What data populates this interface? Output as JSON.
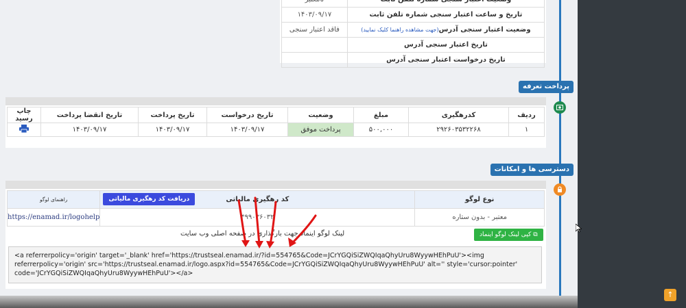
{
  "info_rows": [
    {
      "label": "وضعیت اعتبار سنجی شماره تلفن ثابت",
      "value": "نامعتبر",
      "link": ""
    },
    {
      "label": "تاریخ و ساعت اعتبار سنجی شماره تلفن ثابت",
      "value": "۱۴۰۳/۰۹/۱۷",
      "link": ""
    },
    {
      "label": "وضعیت اعتبار سنجی آدرس",
      "value": "فاقد اعتبار سنجی",
      "link": "(جهت مشاهده راهنما کلیک نمایید)"
    },
    {
      "label": "تاریخ اعتبار سنجی آدرس",
      "value": "",
      "link": ""
    },
    {
      "label": "تاریخ درخواست اعتبار سنجی آدرس",
      "value": "",
      "link": ""
    }
  ],
  "timeline": {
    "payment_label": "پرداخت تعرفه",
    "access_label": "دسترسی ها و امکانات",
    "payment_icon": "money-icon",
    "access_icon": "lock-icon",
    "accent": "#2a72b0"
  },
  "payment": {
    "headers": [
      "ردیف",
      "کدرهگیری",
      "مبلغ",
      "وضعیت",
      "تاریخ درخواست",
      "تاریخ پرداخت",
      "تاریخ انقضا پرداخت",
      "چاپ رسید"
    ],
    "rows": [
      [
        "۱",
        "۲۹۲۶۰۳۵۳۲۲۶۸",
        "۵۰۰,۰۰۰",
        "پرداخت موفق",
        "۱۴۰۳/۰۹/۱۷",
        "۱۴۰۳/۰۹/۱۷",
        "۱۴۰۳/۰۹/۱۷"
      ]
    ]
  },
  "logo": {
    "type_header": "نوع لوگو",
    "tracking_header": "کد رهگیری مالیاتی",
    "guide_header": "راهنمای لوگو",
    "tracking_button": "دریافت کد رهگیری مالیاتی",
    "type_value": "معتبر - بدون ستاره",
    "tracking_value": "۴۹۹۰۳۶۰۳۲",
    "guide_link": "https://enamad.ir/logohelp",
    "copy_button": "کپی لینک لوگو اینماد",
    "instruction": "لینک لوگو اینماد جهت بارگذاری در صفحه اصلی وب سایت",
    "code_text": "<a referrerpolicy='origin' target='_blank' href='https://trustseal.enamad.ir/?id=554765&Code=JCrYGQiSiZWQIqaQhyUru8WyywHEhPuU'><img referrerpolicy='origin' src='https://trustseal.enamad.ir/logo.aspx?id=554765&Code=JCrYGQiSiZWQIqaQhyUru8WyywHEhPuU' alt='' style='cursor:pointer' code='JCrYGQiSiZWQIqaQhyUru8WyywHEhPuU'></a>"
  }
}
